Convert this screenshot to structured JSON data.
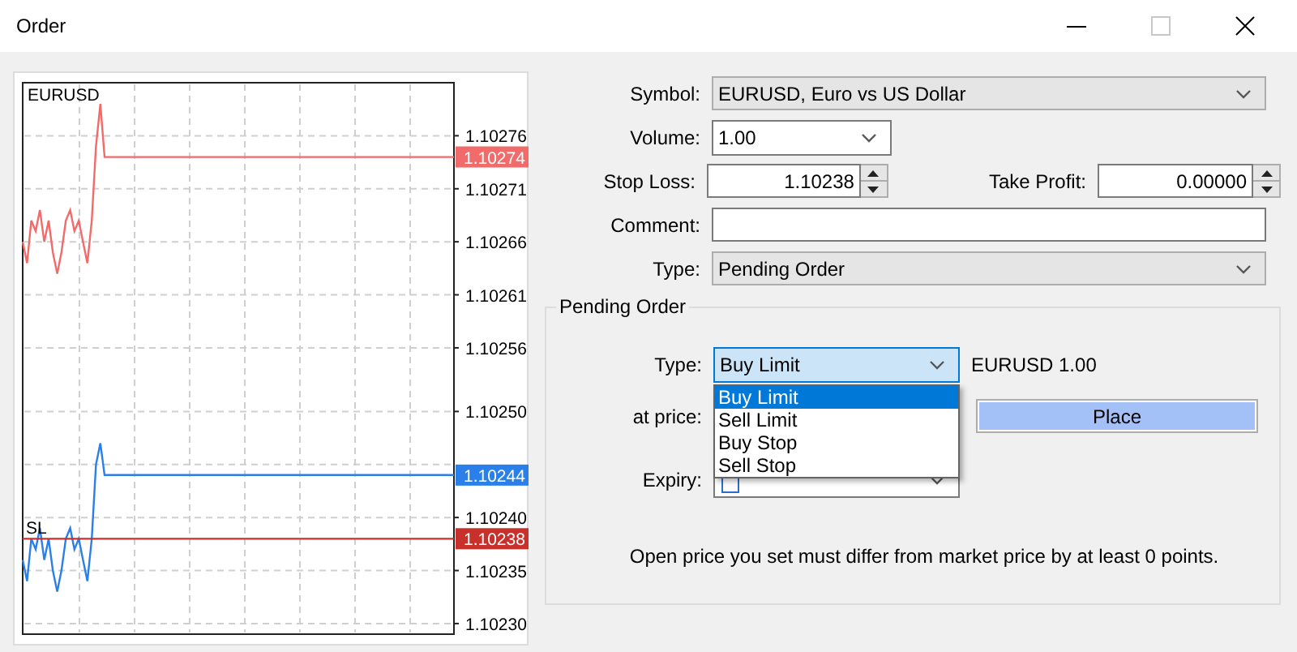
{
  "window": {
    "title": "Order"
  },
  "chart": {
    "chart_data": {
      "type": "line",
      "title": "EURUSD",
      "categories": [
        null,
        null,
        null,
        null,
        null,
        null,
        null,
        null,
        null,
        null,
        null,
        null,
        null,
        null,
        null,
        null,
        null,
        null,
        null,
        null,
        null,
        null,
        null,
        null,
        null,
        null,
        null,
        null,
        null,
        null,
        null,
        null,
        null,
        null,
        null,
        null,
        null,
        null,
        null,
        null,
        null,
        null,
        null,
        null,
        null,
        null,
        null,
        null,
        null,
        null,
        null,
        null,
        null,
        null,
        null,
        null,
        null,
        null,
        null,
        null,
        null,
        null,
        null,
        null,
        null,
        null,
        null,
        null,
        null,
        null,
        null,
        null,
        null,
        null,
        null,
        null,
        null,
        null,
        null,
        null,
        null,
        null,
        null,
        null,
        null,
        null,
        null,
        null,
        null,
        null,
        null,
        null,
        null,
        null,
        null,
        null,
        null,
        null,
        null,
        null,
        null
      ],
      "ylim": [
        1.10229,
        1.10281
      ],
      "yticks": [
        1.10276,
        1.10271,
        1.10266,
        1.10261,
        1.10256,
        {
          "value": 1.1025,
          "label": "1.10250"
        },
        {
          "value": 1.1024,
          "label": "1.10240"
        },
        1.10235,
        {
          "value": 1.1023,
          "label": "1.10230"
        }
      ],
      "grid": true,
      "series": [
        {
          "color": "#f26b6b",
          "values": [
            1.10266,
            1.10264,
            1.10268,
            1.10267,
            1.10269,
            1.10266,
            1.10268,
            1.10265,
            1.10263,
            1.10265,
            1.10268,
            1.10269,
            1.10267,
            1.10268,
            1.10266,
            1.10264,
            1.10268,
            1.10275,
            1.10279,
            1.10274,
            1.10274,
            1.10274,
            1.10274,
            1.10274,
            1.10274,
            1.10274,
            1.10274,
            1.10274,
            1.10274,
            1.10274,
            1.10274,
            1.10274,
            1.10274,
            1.10274,
            1.10274,
            1.10274,
            1.10274,
            1.10274,
            1.10274,
            1.10274,
            1.10274,
            1.10274,
            1.10274,
            1.10274,
            1.10274,
            1.10274,
            1.10274,
            1.10274,
            1.10274,
            1.10274,
            1.10274,
            1.10274,
            1.10274,
            1.10274,
            1.10274,
            1.10274,
            1.10274,
            1.10274,
            1.10274,
            1.10274,
            1.10274,
            1.10274,
            1.10274,
            1.10274,
            1.10274,
            1.10274,
            1.10274,
            1.10274,
            1.10274,
            1.10274,
            1.10274,
            1.10274,
            1.10274,
            1.10274,
            1.10274,
            1.10274,
            1.10274,
            1.10274,
            1.10274,
            1.10274,
            1.10274,
            1.10274,
            1.10274,
            1.10274,
            1.10274,
            1.10274,
            1.10274,
            1.10274,
            1.10274,
            1.10274,
            1.10274,
            1.10274,
            1.10274,
            1.10274,
            1.10274,
            1.10274,
            1.10274,
            1.10274,
            1.10274,
            1.10274,
            1.10274
          ]
        },
        {
          "color": "#2a7fe8",
          "values": [
            1.10236,
            1.10234,
            1.10238,
            1.10237,
            1.10239,
            1.10236,
            1.10238,
            1.10235,
            1.10233,
            1.10235,
            1.10238,
            1.10239,
            1.10237,
            1.10238,
            1.10236,
            1.10234,
            1.10238,
            1.10245,
            1.10247,
            1.10244,
            1.10244,
            1.10244,
            1.10244,
            1.10244,
            1.10244,
            1.10244,
            1.10244,
            1.10244,
            1.10244,
            1.10244,
            1.10244,
            1.10244,
            1.10244,
            1.10244,
            1.10244,
            1.10244,
            1.10244,
            1.10244,
            1.10244,
            1.10244,
            1.10244,
            1.10244,
            1.10244,
            1.10244,
            1.10244,
            1.10244,
            1.10244,
            1.10244,
            1.10244,
            1.10244,
            1.10244,
            1.10244,
            1.10244,
            1.10244,
            1.10244,
            1.10244,
            1.10244,
            1.10244,
            1.10244,
            1.10244,
            1.10244,
            1.10244,
            1.10244,
            1.10244,
            1.10244,
            1.10244,
            1.10244,
            1.10244,
            1.10244,
            1.10244,
            1.10244,
            1.10244,
            1.10244,
            1.10244,
            1.10244,
            1.10244,
            1.10244,
            1.10244,
            1.10244,
            1.10244,
            1.10244,
            1.10244,
            1.10244,
            1.10244,
            1.10244,
            1.10244,
            1.10244,
            1.10244,
            1.10244,
            1.10244,
            1.10244,
            1.10244,
            1.10244,
            1.10244,
            1.10244,
            1.10244,
            1.10244,
            1.10244,
            1.10244,
            1.10244,
            1.10244
          ]
        },
        {
          "name": "SL",
          "color": "#c8302c",
          "values": [
            1.10238,
            1.10238,
            1.10238,
            1.10238,
            1.10238,
            1.10238,
            1.10238,
            1.10238,
            1.10238,
            1.10238,
            1.10238,
            1.10238,
            1.10238,
            1.10238,
            1.10238,
            1.10238,
            1.10238,
            1.10238,
            1.10238,
            1.10238,
            1.10238,
            1.10238,
            1.10238,
            1.10238,
            1.10238,
            1.10238,
            1.10238,
            1.10238,
            1.10238,
            1.10238,
            1.10238,
            1.10238,
            1.10238,
            1.10238,
            1.10238,
            1.10238,
            1.10238,
            1.10238,
            1.10238,
            1.10238,
            1.10238,
            1.10238,
            1.10238,
            1.10238,
            1.10238,
            1.10238,
            1.10238,
            1.10238,
            1.10238,
            1.10238,
            1.10238,
            1.10238,
            1.10238,
            1.10238,
            1.10238,
            1.10238,
            1.10238,
            1.10238,
            1.10238,
            1.10238,
            1.10238,
            1.10238,
            1.10238,
            1.10238,
            1.10238,
            1.10238,
            1.10238,
            1.10238,
            1.10238,
            1.10238,
            1.10238,
            1.10238,
            1.10238,
            1.10238,
            1.10238,
            1.10238,
            1.10238,
            1.10238,
            1.10238,
            1.10238,
            1.10238,
            1.10238,
            1.10238,
            1.10238,
            1.10238,
            1.10238,
            1.10238,
            1.10238,
            1.10238,
            1.10238,
            1.10238,
            1.10238,
            1.10238,
            1.10238,
            1.10238,
            1.10238,
            1.10238,
            1.10238,
            1.10238,
            1.10238,
            1.10238
          ]
        }
      ]
    },
    "price_tags": [
      {
        "text": "1.10274",
        "color": "#f26b6b"
      },
      {
        "text": "1.10244",
        "color": "#2a7fe8"
      },
      {
        "text": "1.10238",
        "color": "#c8302c"
      }
    ]
  },
  "order": {
    "symbol": {
      "label": "Symbol:",
      "value": "EURUSD, Euro vs US Dollar"
    },
    "volume": {
      "label": "Volume:",
      "value": "1.00"
    },
    "stop_loss": {
      "label": "Stop Loss:",
      "value": "1.10238"
    },
    "take_profit": {
      "label": "Take Profit:",
      "value": "0.00000"
    },
    "comment": {
      "label": "Comment:"
    },
    "type": {
      "label": "Type:",
      "value": "Pending Order"
    }
  },
  "pending_order": {
    "title": "Pending Order",
    "type": {
      "label": "Type:",
      "value": "Buy Limit",
      "open": true,
      "options": [
        {
          "label": "Buy Limit",
          "selected": true
        },
        {
          "label": "Sell Limit",
          "selected": false
        },
        {
          "label": "Buy Stop",
          "selected": false
        },
        {
          "label": "Sell Stop",
          "selected": false
        }
      ]
    },
    "summary": "EURUSD 1.00",
    "price": {
      "label": "at price:"
    },
    "place_button": "Place",
    "expiry": {
      "label": "Expiry:",
      "checked": false
    },
    "message": "Open price you set must differ from market price by at least 0 points."
  }
}
